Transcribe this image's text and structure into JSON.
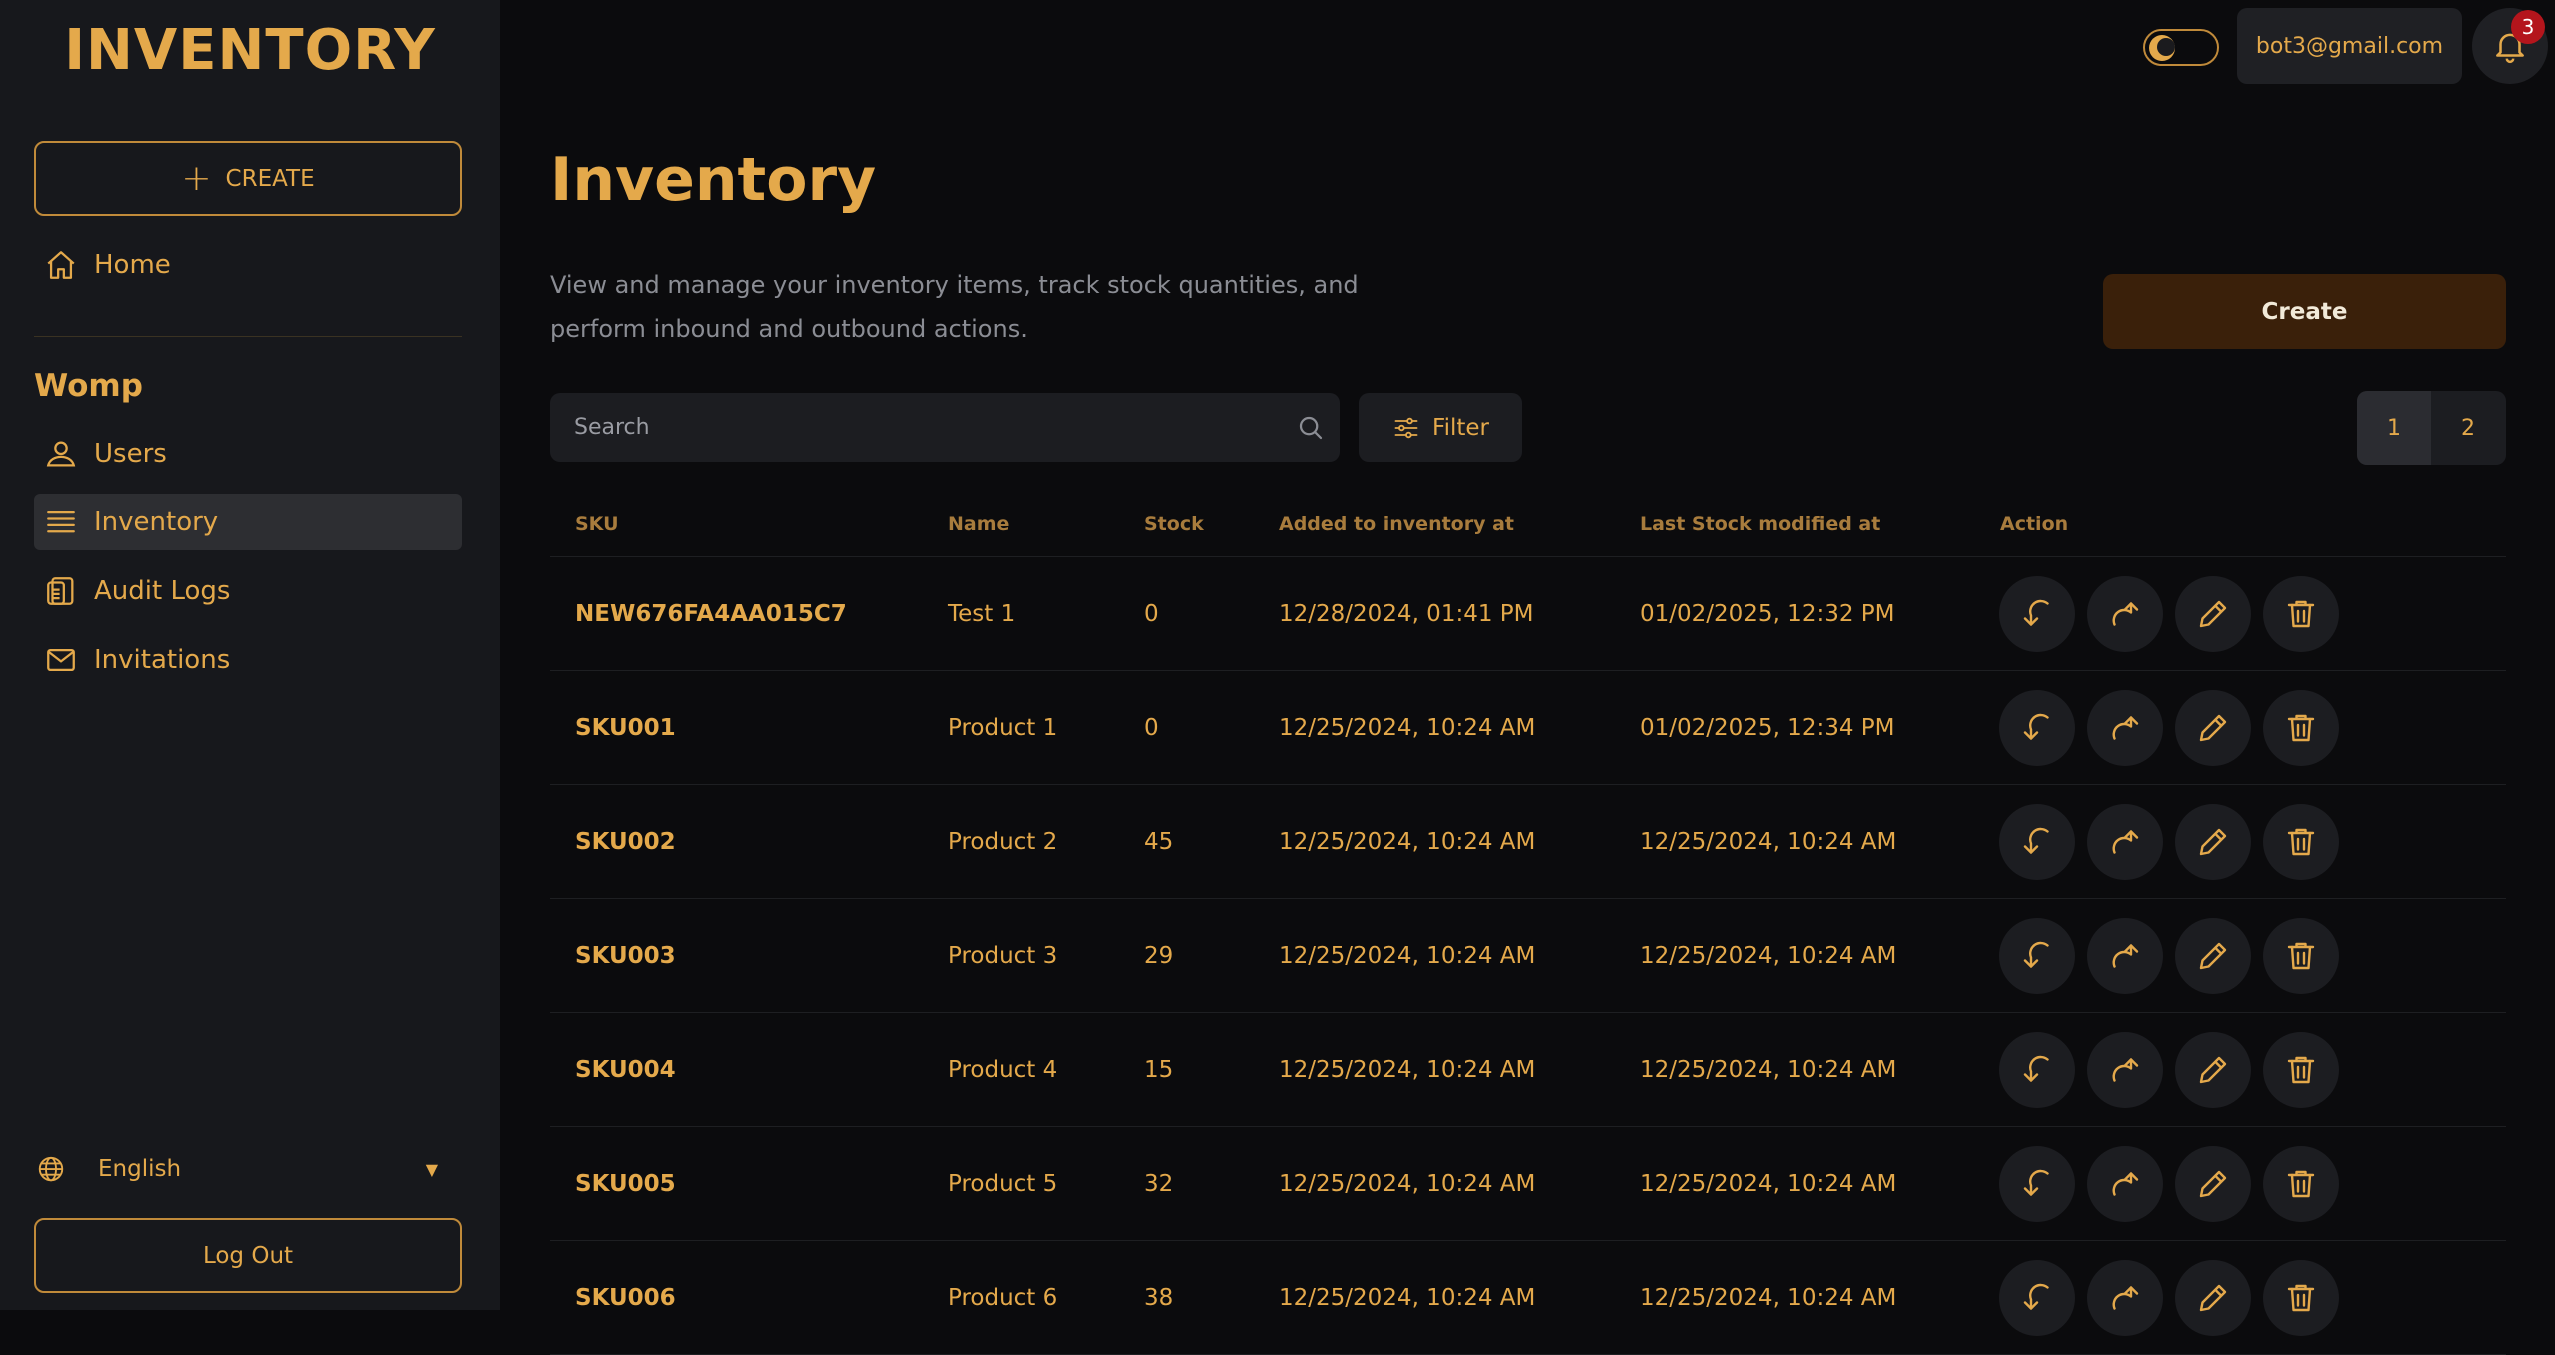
{
  "app": {
    "logo": "INVENTORY"
  },
  "sidebar": {
    "create_label": "CREATE",
    "home_label": "Home",
    "section_title": "Womp",
    "items": [
      {
        "label": "Users",
        "icon": "users-icon"
      },
      {
        "label": "Inventory",
        "icon": "list-icon",
        "active": true
      },
      {
        "label": "Audit Logs",
        "icon": "clipboard-icon"
      },
      {
        "label": "Invitations",
        "icon": "mail-icon"
      }
    ],
    "language": "English",
    "logout_label": "Log Out"
  },
  "topbar": {
    "email": "bot3@gmail.com",
    "notification_count": "3",
    "theme": "dark"
  },
  "main": {
    "title": "Inventory",
    "description": "View and manage your inventory items, track stock quantities, and perform inbound and outbound actions.",
    "create_label": "Create",
    "search_placeholder": "Search",
    "filter_label": "Filter",
    "pages": [
      "1",
      "2"
    ],
    "current_page": "1"
  },
  "table": {
    "headers": {
      "sku": "SKU",
      "name": "Name",
      "stock": "Stock",
      "added": "Added to inventory at",
      "modified": "Last Stock modified at",
      "action": "Action"
    },
    "rows": [
      {
        "sku": "NEW676FA4AA015C7",
        "name": "Test 1",
        "stock": "0",
        "added": "12/28/2024, 01:41 PM",
        "modified": "01/02/2025, 12:32 PM"
      },
      {
        "sku": "SKU001",
        "name": "Product 1",
        "stock": "0",
        "added": "12/25/2024, 10:24 AM",
        "modified": "01/02/2025, 12:34 PM"
      },
      {
        "sku": "SKU002",
        "name": "Product 2",
        "stock": "45",
        "added": "12/25/2024, 10:24 AM",
        "modified": "12/25/2024, 10:24 AM"
      },
      {
        "sku": "SKU003",
        "name": "Product 3",
        "stock": "29",
        "added": "12/25/2024, 10:24 AM",
        "modified": "12/25/2024, 10:24 AM"
      },
      {
        "sku": "SKU004",
        "name": "Product 4",
        "stock": "15",
        "added": "12/25/2024, 10:24 AM",
        "modified": "12/25/2024, 10:24 AM"
      },
      {
        "sku": "SKU005",
        "name": "Product 5",
        "stock": "32",
        "added": "12/25/2024, 10:24 AM",
        "modified": "12/25/2024, 10:24 AM"
      },
      {
        "sku": "SKU006",
        "name": "Product 6",
        "stock": "38",
        "added": "12/25/2024, 10:24 AM",
        "modified": "12/25/2024, 10:24 AM"
      }
    ]
  },
  "colors": {
    "accent": "#e4a94b",
    "background": "#0b0b0d",
    "sidebar": "#17181c",
    "create_button": "#3a200a",
    "badge": "#b4151c"
  }
}
